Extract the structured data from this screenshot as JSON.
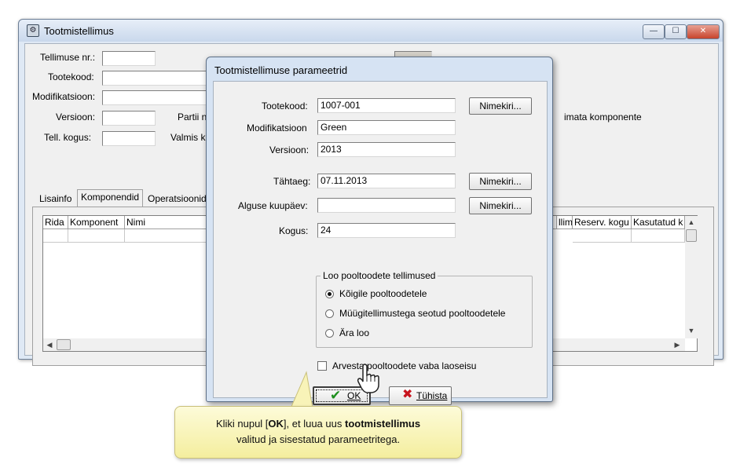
{
  "main_window": {
    "title": "Tootmistellimus",
    "controls": {
      "minimize": "—",
      "maximize": "☐",
      "close": "✕"
    },
    "fields": {
      "order_no_label": "Tellimuse nr.:",
      "product_code_label": "Tootekood:",
      "modification_label": "Modifikatsioon:",
      "version_label": "Versioon:",
      "order_qty_label": "Tell. kogus:",
      "batch_label": "Partii nr",
      "done_label": "Valmis ko",
      "components_partial": "imata komponente"
    },
    "tabs": [
      "Lisainfo",
      "Komponendid",
      "Operatsioonid"
    ],
    "active_tab": "Komponendid",
    "grid_columns": [
      "Rida",
      "Komponent",
      "Nimi",
      "llim.",
      "Reserv. kogu",
      "Kasutatud k"
    ]
  },
  "dialog": {
    "title": "Tootmistellimuse parameetrid",
    "product_code": {
      "label": "Tootekood:",
      "value": "1007-001",
      "button": "Nimekiri..."
    },
    "modification": {
      "label": "Modifikatsioon",
      "value": "Green"
    },
    "version": {
      "label": "Versioon:",
      "value": "2013"
    },
    "deadline": {
      "label": "Tähtaeg:",
      "value": "07.11.2013",
      "button": "Nimekiri..."
    },
    "start_date": {
      "label": "Alguse kuupäev:",
      "value": "",
      "button": "Nimekiri..."
    },
    "quantity": {
      "label": "Kogus:",
      "value": "24"
    },
    "group": {
      "title": "Loo pooltoodete tellimused",
      "options": [
        "Kõigile pooltoodetele",
        "Müügitellimustega seotud pooltoodetele",
        "Ära loo"
      ],
      "selected": "Kõigile pooltoodetele"
    },
    "checkbox": {
      "label": "Arvesta pooltoodete vaba laoseisu",
      "checked": false
    },
    "ok_button": "OK",
    "cancel_button": "Tühista"
  },
  "callout": {
    "line1_prefix": "Kliki nupul [",
    "line1_bold": "OK",
    "line1_mid": "], et luua uus ",
    "line1_bold2": "tootmistellimus",
    "line2": "valitud ja sisestatud parameetritega."
  },
  "colors": {
    "ok_check": "#1e8f1e",
    "cancel_x": "#c8141e",
    "callout_bg": "#f8f3b8"
  }
}
